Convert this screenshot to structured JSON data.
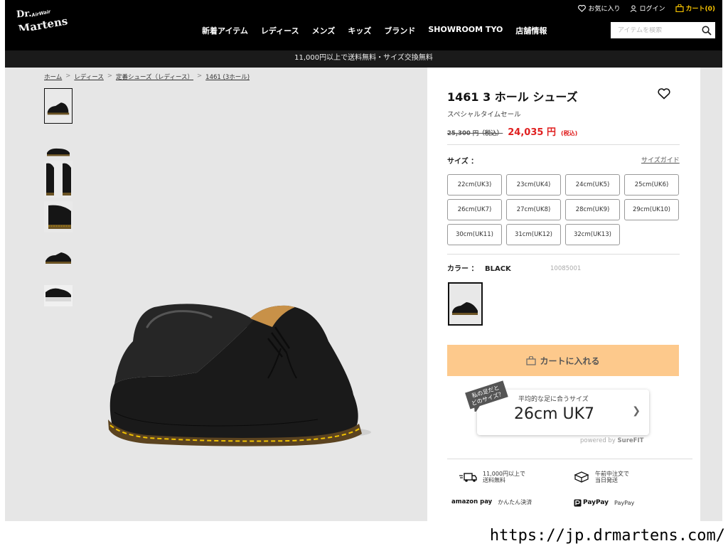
{
  "header": {
    "logo_text": "Dr. Martens AirWair",
    "util": {
      "favorites": "お気に入り",
      "login": "ログイン",
      "cart": "カート(0)"
    },
    "nav": [
      "新着アイテム",
      "レディース",
      "メンズ",
      "キッズ",
      "ブランド",
      "SHOWROOM TYO",
      "店舗情報"
    ],
    "search_placeholder": "アイテムを検索"
  },
  "banner": "11,000円以上で送料無料・サイズ交換無料",
  "breadcrumb": [
    "ホーム",
    "レディース",
    "定番シューズ（レディース）",
    "1461 (3ホール)"
  ],
  "product": {
    "title": "1461 3 ホール シューズ",
    "sale_label": "スペシャルタイムセール",
    "old_price": "25,300 円（税込）",
    "new_price": "24,035 円",
    "tax_label": "(税込)",
    "size_label": "サイズ ：",
    "size_guide": "サイズガイド",
    "sizes": [
      "22cm(UK3)",
      "23cm(UK4)",
      "24cm(UK5)",
      "25cm(UK6)",
      "26cm(UK7)",
      "27cm(UK8)",
      "28cm(UK9)",
      "29cm(UK10)",
      "30cm(UK11)",
      "31cm(UK12)",
      "32cm(UK13)"
    ],
    "color_label": "カラー ：",
    "color_value": "BLACK",
    "sku": "10085001",
    "cart_button": "カートに入れる"
  },
  "fit": {
    "badge_line1": "私の足だと",
    "badge_line2": "どのサイズ？",
    "subtitle": "平均的な足に合うサイズ",
    "value": "26cm UK7",
    "powered_prefix": "powered by ",
    "powered_brand": "SureFIT"
  },
  "features": {
    "shipping_line1": "11,000円以上で",
    "shipping_line2": "送料無料",
    "sameday_line1": "午前中注文で",
    "sameday_line2": "当日発送",
    "amazon_logo": "amazon pay",
    "amazon_text": "かんたん決済",
    "paypay_logo": "PayPay",
    "paypay_text": "PayPay"
  },
  "url": "https://jp.drmartens.com/"
}
